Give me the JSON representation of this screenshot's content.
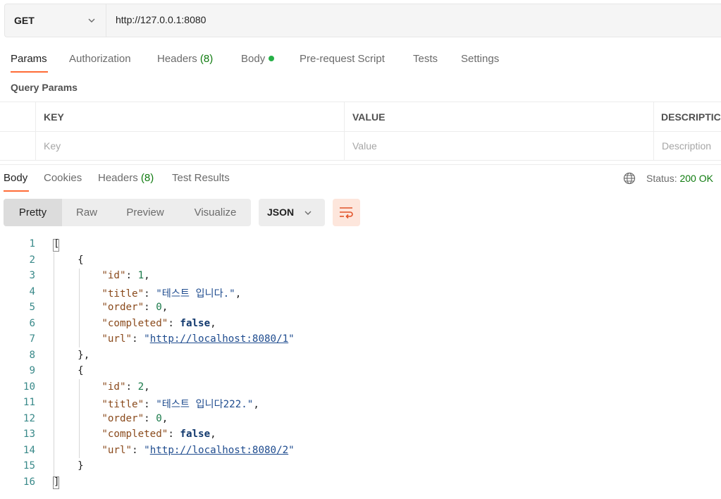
{
  "request": {
    "method": "GET",
    "url": "http://127.0.0.1:8080"
  },
  "req_tabs": {
    "params": "Params",
    "authorization": "Authorization",
    "headers": "Headers",
    "headers_count": "(8)",
    "body": "Body",
    "prerequest": "Pre-request Script",
    "tests": "Tests",
    "settings": "Settings"
  },
  "query_params": {
    "title": "Query Params",
    "columns": [
      "KEY",
      "VALUE",
      "DESCRIPTIC"
    ],
    "placeholders": [
      "Key",
      "Value",
      "Description"
    ]
  },
  "response": {
    "tabs": {
      "body": "Body",
      "cookies": "Cookies",
      "headers": "Headers",
      "headers_count": "(8)",
      "test_results": "Test Results"
    },
    "status_label": "Status:",
    "status_value": "200 OK",
    "views": [
      "Pretty",
      "Raw",
      "Preview",
      "Visualize"
    ],
    "format": "JSON"
  },
  "code": {
    "line_numbers": [
      "1",
      "2",
      "3",
      "4",
      "5",
      "6",
      "7",
      "8",
      "9",
      "10",
      "11",
      "12",
      "13",
      "14",
      "15",
      "16"
    ],
    "items": [
      {
        "id": "1",
        "title": "\"테스트 입니다.\"",
        "order": "0",
        "completed": "false",
        "url": "http://localhost:8080/1"
      },
      {
        "id": "2",
        "title": "\"테스트 입니다222.\"",
        "order": "0",
        "completed": "false",
        "url": "http://localhost:8080/2"
      }
    ],
    "keys": {
      "id": "\"id\"",
      "title": "\"title\"",
      "order": "\"order\"",
      "completed": "\"completed\"",
      "url": "\"url\""
    }
  },
  "colors": {
    "accent": "#ff6c37",
    "status_ok": "#0f7b0f",
    "body_dot": "#26b047"
  }
}
